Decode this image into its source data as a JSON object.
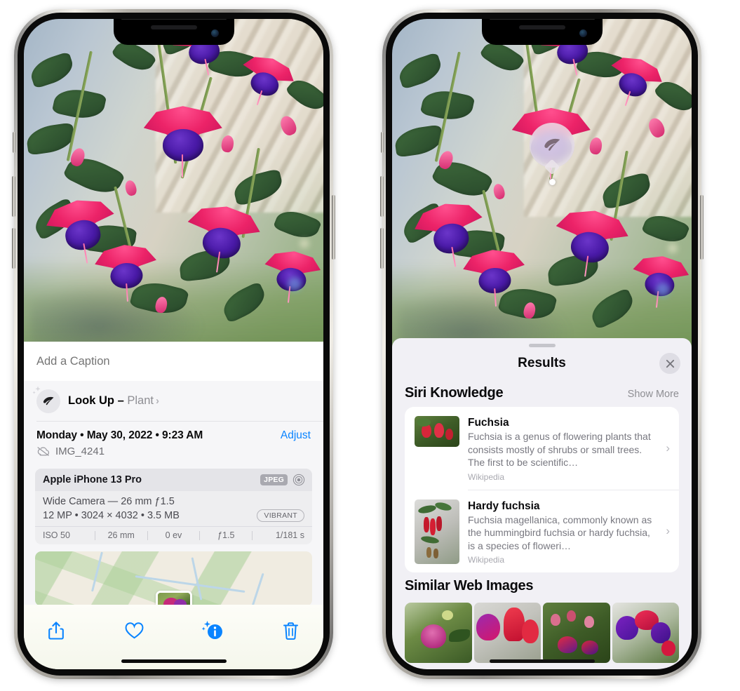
{
  "page": {
    "description": "Two iPhone screenshots side by side showing Photos app info panel with Visual Look Up, and the Visual Look Up Results sheet"
  },
  "left_phone": {
    "photo": {
      "alt": "Fuchsia flowers in hanging basket",
      "icon": "photo"
    },
    "caption": {
      "placeholder": "Add a Caption",
      "value": ""
    },
    "lookup": {
      "leaf_icon": "leaf-icon",
      "sparkle_icon": "sparkle-icon",
      "label": "Look Up – ",
      "subject": "Plant",
      "chevron": "›"
    },
    "metadata": {
      "date_line": "Monday • May 30, 2022 • 9:23 AM",
      "adjust_label": "Adjust",
      "cloud_icon": "cloud-slash-icon",
      "file_name": "IMG_4241"
    },
    "camera": {
      "model": "Apple iPhone 13 Pro",
      "format_badge": "JPEG",
      "lens_icon": "lens-icon",
      "lens_line": "Wide Camera — 26 mm ƒ1.5",
      "specs_line": "12 MP • 3024 × 4032 • 3.5 MB",
      "style_badge": "VIBRANT",
      "exif": [
        "ISO 50",
        "26 mm",
        "0 ev",
        "ƒ1.5",
        "1/181 s"
      ]
    },
    "map": {
      "alt": "Map location thumbnail with photo pin"
    },
    "toolbar": {
      "items": [
        {
          "name": "share-icon",
          "label": "Share"
        },
        {
          "name": "heart-icon",
          "label": "Favorite"
        },
        {
          "name": "info-sparkle-icon",
          "label": "Info"
        },
        {
          "name": "trash-icon",
          "label": "Delete"
        }
      ]
    }
  },
  "right_phone": {
    "photo": {
      "alt": "Fuchsia flowers in hanging basket"
    },
    "visual_lookup_badge": {
      "icon": "leaf-icon"
    },
    "sheet": {
      "title": "Results",
      "close_icon": "close-icon",
      "siri_knowledge": {
        "heading": "Siri Knowledge",
        "show_more": "Show More",
        "items": [
          {
            "title": "Fuchsia",
            "description": "Fuchsia is a genus of flowering plants that consists mostly of shrubs or small trees. The first to be scientific…",
            "source": "Wikipedia",
            "thumb_alt": "Red fuchsia flowers"
          },
          {
            "title": "Hardy fuchsia",
            "description": "Fuchsia magellanica, commonly known as the hummingbird fuchsia or hardy fuchsia, is a species of floweri…",
            "source": "Wikipedia",
            "thumb_alt": "Hardy fuchsia specimen sheet"
          }
        ]
      },
      "similar_web_images": {
        "heading": "Similar Web Images",
        "tiles": [
          {
            "alt": "Magenta fuchsia with green leaves"
          },
          {
            "alt": "Red and purple fuchsia close-up"
          },
          {
            "alt": "Fuchsia shrub with many buds"
          },
          {
            "alt": "Purple and red fuchsia blooms"
          }
        ]
      }
    }
  },
  "colors": {
    "accent_blue": "#0a84ff",
    "sheet_background": "#f1f0f5",
    "panel_background": "#f6f6f8",
    "card_background": "#ffffff",
    "muted_text": "#8e8e93"
  }
}
